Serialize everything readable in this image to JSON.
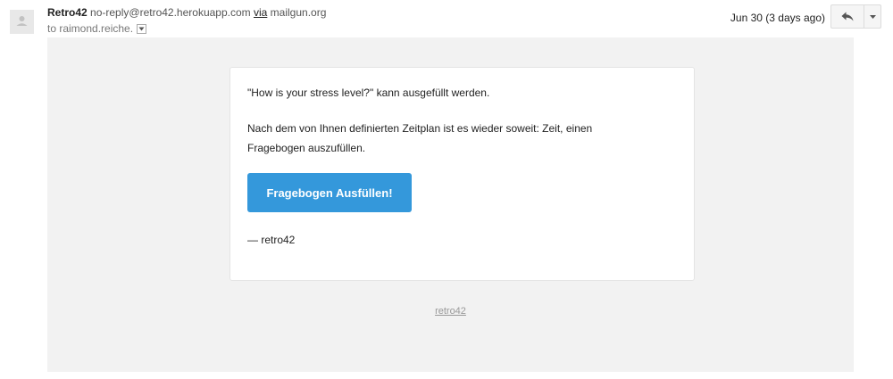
{
  "header": {
    "sender_name": "Retro42",
    "sender_email": "no-reply@retro42.herokuapp.com",
    "via_label": "via",
    "via_domain": "mailgun.org",
    "recipient_text": "to raimond.reiche.",
    "date": "Jun 30 (3 days ago)",
    "icons": {
      "avatar": "person-icon",
      "reply": "reply-arrow-icon",
      "more": "chevron-down-icon"
    }
  },
  "message": {
    "line1": "\"How is your stress level?\" kann ausgefüllt werden.",
    "line2": "Nach dem von Ihnen definierten Zeitplan ist es wieder soweit: Zeit, einen",
    "line3": "Fragebogen auszufüllen.",
    "button_label": "Fragebogen Ausfüllen!",
    "signature": "— retro42",
    "footer_link": "retro42"
  },
  "colors": {
    "button": "#3498db",
    "mail_background": "#f2f2f2",
    "card_background": "#ffffff"
  }
}
